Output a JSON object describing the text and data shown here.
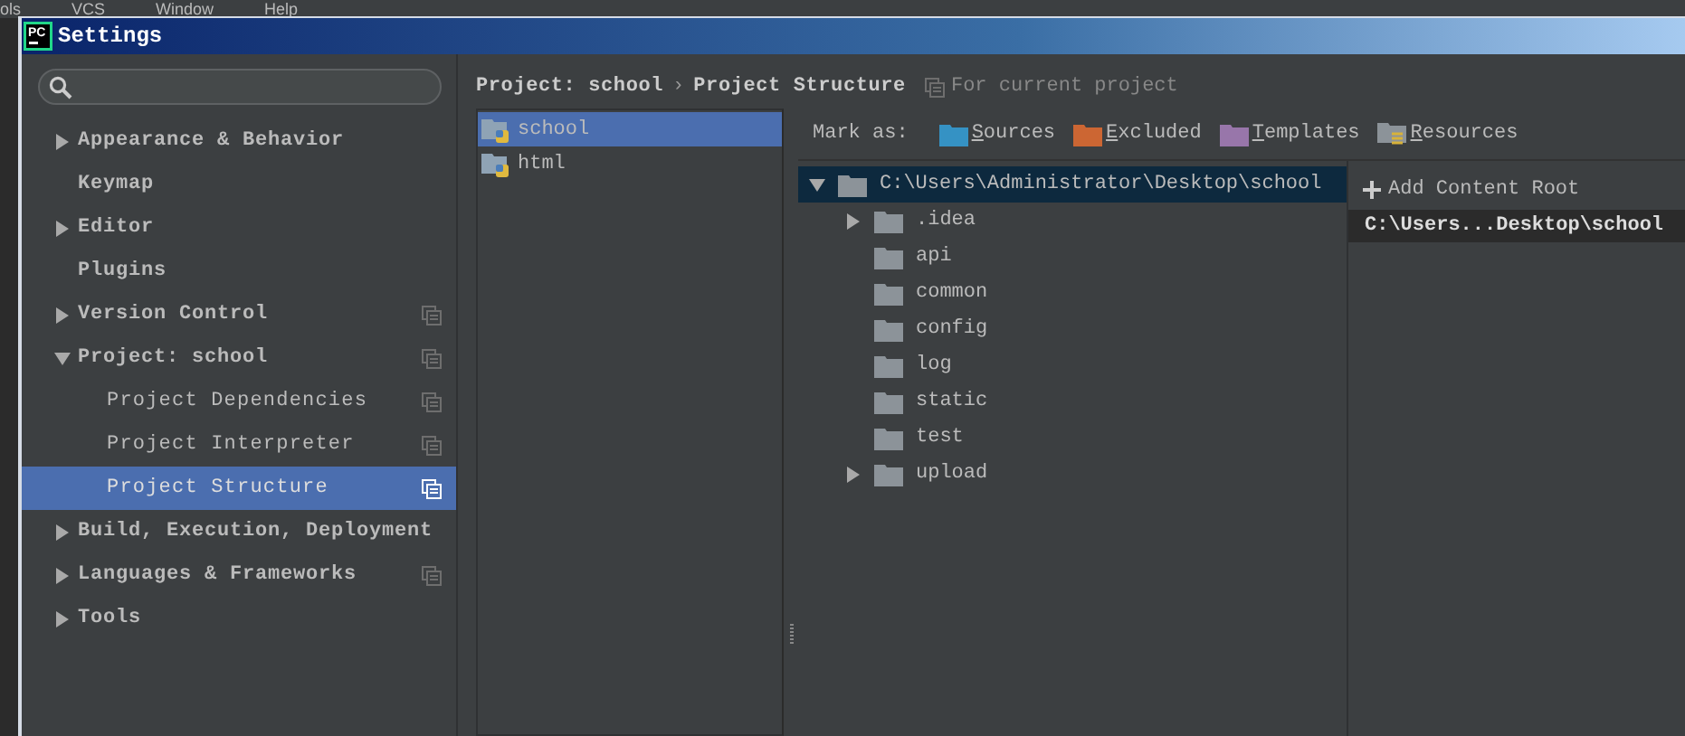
{
  "menubar": [
    "ols",
    "VCS",
    "Window",
    "Help"
  ],
  "window": {
    "logo": "PC",
    "title": "Settings"
  },
  "sidebar": {
    "items": [
      {
        "label": "Appearance & Behavior",
        "expanded": false
      },
      {
        "label": "Keymap"
      },
      {
        "label": "Editor",
        "expanded": false
      },
      {
        "label": "Plugins"
      },
      {
        "label": "Version Control",
        "expanded": false,
        "project_scope": true
      },
      {
        "label": "Project: school",
        "expanded": true,
        "project_scope": true,
        "children": [
          {
            "label": "Project Dependencies",
            "project_scope": true,
            "selected": false
          },
          {
            "label": "Project Interpreter",
            "project_scope": true,
            "selected": false
          },
          {
            "label": "Project Structure",
            "project_scope": true,
            "selected": true
          }
        ]
      },
      {
        "label": "Build, Execution, Deployment",
        "expanded": false
      },
      {
        "label": "Languages & Frameworks",
        "expanded": false,
        "project_scope": true
      },
      {
        "label": "Tools",
        "expanded": false
      }
    ]
  },
  "breadcrumb": {
    "path": [
      "Project: school",
      "Project Structure"
    ],
    "separator": "›",
    "scope_note": "For current project"
  },
  "modules": [
    {
      "name": "school",
      "selected": true
    },
    {
      "name": "html",
      "selected": false
    }
  ],
  "mark_as": {
    "label": "Mark as:",
    "options": [
      {
        "label": "Sources",
        "kind": "folder",
        "color": "#3592c4"
      },
      {
        "label": "Excluded",
        "kind": "folder",
        "color": "#cc6633"
      },
      {
        "label": "Templates",
        "kind": "folder",
        "color": "#9876aa"
      },
      {
        "label": "Resources",
        "kind": "resources",
        "color": "#8c9399"
      }
    ]
  },
  "content_tree": {
    "label": "C:\\Users\\Administrator\\Desktop\\school",
    "expanded": true,
    "selected": true,
    "children": [
      {
        "label": ".idea",
        "expanded": false
      },
      {
        "label": "api"
      },
      {
        "label": "common"
      },
      {
        "label": "config"
      },
      {
        "label": "log"
      },
      {
        "label": "static"
      },
      {
        "label": "test"
      },
      {
        "label": "upload",
        "expanded": false
      }
    ]
  },
  "content_roots": {
    "add_button": "Add Content Root",
    "roots": [
      {
        "label": "C:\\Users...Desktop\\school",
        "selected": true
      }
    ]
  }
}
